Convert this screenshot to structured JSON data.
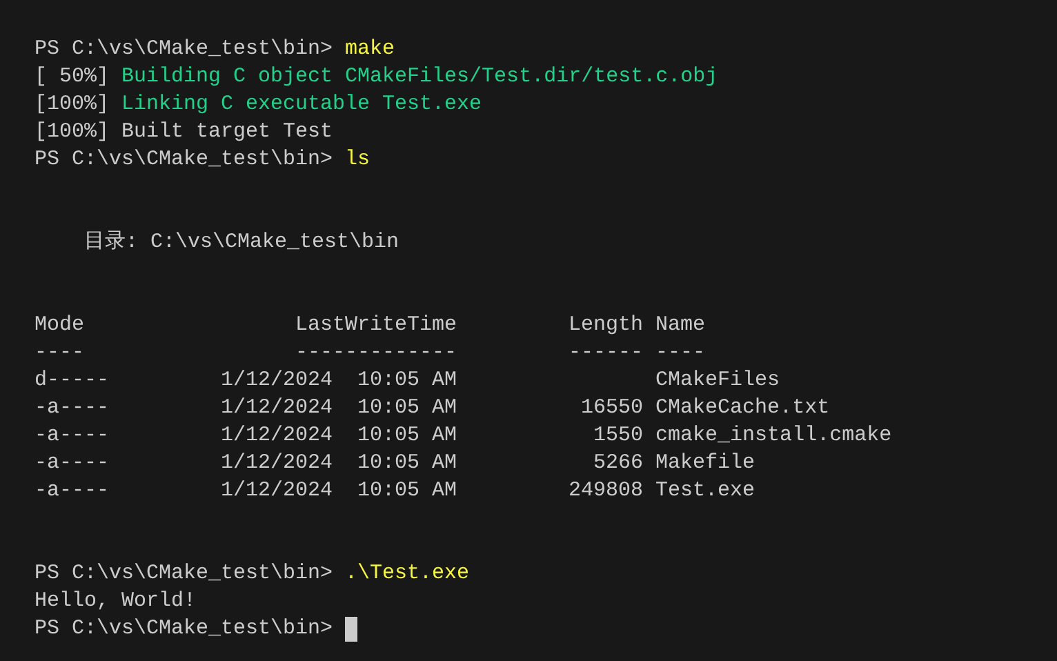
{
  "terminal": {
    "lines": [
      {
        "kind": "prompt",
        "prompt": "PS C:\\vs\\CMake_test\\bin>",
        "command": "make"
      },
      {
        "kind": "progress",
        "percent": "[ 50%]",
        "message": "Building C object CMakeFiles/Test.dir/test.c.obj"
      },
      {
        "kind": "progress",
        "percent": "[100%]",
        "message": "Linking C executable Test.exe"
      },
      {
        "kind": "output",
        "text": "[100%] Built target Test"
      },
      {
        "kind": "prompt",
        "prompt": "PS C:\\vs\\CMake_test\\bin>",
        "command": "ls"
      },
      {
        "kind": "blank"
      },
      {
        "kind": "blank"
      },
      {
        "kind": "directory",
        "label": "目录:",
        "path": "C:\\vs\\CMake_test\\bin"
      },
      {
        "kind": "blank"
      },
      {
        "kind": "blank"
      },
      {
        "kind": "table_header",
        "mode": "Mode",
        "time": "LastWriteTime",
        "length": "Length",
        "name": "Name"
      },
      {
        "kind": "table_rule",
        "mode": "----",
        "time": "-------------",
        "length": "------",
        "name": "----"
      },
      {
        "kind": "table_row",
        "mode": "d-----",
        "time": "1/12/2024  10:05 AM",
        "name": "CMakeFiles"
      },
      {
        "kind": "table_row",
        "mode": "-a----",
        "time": "1/12/2024  10:05 AM",
        "length": "16550",
        "name": "CMakeCache.txt"
      },
      {
        "kind": "table_row",
        "mode": "-a----",
        "time": "1/12/2024  10:05 AM",
        "length": "1550",
        "name": "cmake_install.cmake"
      },
      {
        "kind": "table_row",
        "mode": "-a----",
        "time": "1/12/2024  10:05 AM",
        "length": "5266",
        "name": "Makefile"
      },
      {
        "kind": "table_row",
        "mode": "-a----",
        "time": "1/12/2024  10:05 AM",
        "length": "249808",
        "name": "Test.exe"
      },
      {
        "kind": "blank"
      },
      {
        "kind": "blank"
      },
      {
        "kind": "prompt",
        "prompt": "PS C:\\vs\\CMake_test\\bin>",
        "command": ".\\Test.exe"
      },
      {
        "kind": "output",
        "text": "Hello, World!"
      },
      {
        "kind": "prompt",
        "prompt": "PS C:\\vs\\CMake_test\\bin>",
        "cursor": true
      }
    ]
  }
}
